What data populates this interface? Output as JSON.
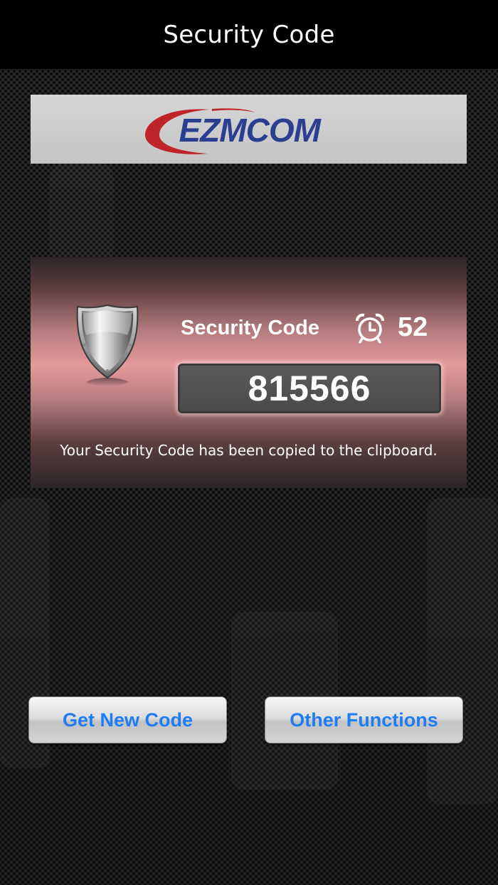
{
  "nav": {
    "title": "Security Code"
  },
  "logo": {
    "text": "EZMCOM",
    "icon": "ezmcom-logo"
  },
  "security": {
    "label": "Security Code",
    "countdown_seconds": "52",
    "code": "815566",
    "copied_message": "Your Security Code has been copied to the clipboard.",
    "shield_icon": "shield-icon",
    "timer_icon": "alarm-clock-icon"
  },
  "actions": {
    "get_new_code_label": "Get New Code",
    "other_functions_label": "Other Functions"
  },
  "colors": {
    "nav_background": "#000000",
    "button_text": "#1f7cf2",
    "logo_blue": "#2a3f8f",
    "logo_red": "#c0242b",
    "panel_pink": "#e59a9b"
  }
}
